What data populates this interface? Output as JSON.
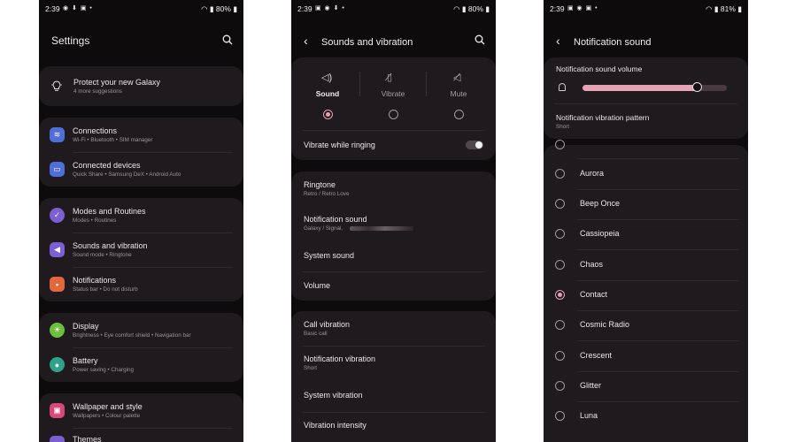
{
  "status": {
    "p1": {
      "time": "2:39",
      "right": "80%"
    },
    "p2": {
      "time": "2:39",
      "right": "80%"
    },
    "p3": {
      "time": "2:39",
      "right": "81%"
    }
  },
  "settings": {
    "title": "Settings",
    "promo": {
      "title": "Protect your new Galaxy",
      "subtitle": "4 more suggestions"
    },
    "items": [
      {
        "title": "Connections",
        "subtitle": "Wi-Fi  •  Bluetooth  •  SIM manager",
        "icon": "wifi-icon",
        "color": "#4f6ed8"
      },
      {
        "title": "Connected devices",
        "subtitle": "Quick Share  •  Samsung DeX  •  Android Auto",
        "icon": "devices-icon",
        "color": "#4f6ed8"
      },
      {
        "title": "Modes and Routines",
        "subtitle": "Modes  •  Routines",
        "icon": "check-circle-icon",
        "color": "#7b5fd3"
      },
      {
        "title": "Sounds and vibration",
        "subtitle": "Sound mode  •  Ringtone",
        "icon": "speaker-icon",
        "color": "#7b5fd3"
      },
      {
        "title": "Notifications",
        "subtitle": "Status bar  •  Do not disturb",
        "icon": "bell-icon",
        "color": "#e2683c"
      },
      {
        "title": "Display",
        "subtitle": "Brightness  •  Eye comfort shield  •  Navigation bar",
        "icon": "sun-icon",
        "color": "#6fbf3f"
      },
      {
        "title": "Battery",
        "subtitle": "Power saving  •  Charging",
        "icon": "battery-icon",
        "color": "#2fa38a"
      },
      {
        "title": "Wallpaper and style",
        "subtitle": "Wallpapers  •  Colour palette",
        "icon": "palette-icon",
        "color": "#d9467e"
      },
      {
        "title": "Themes",
        "subtitle": "",
        "icon": "themes-icon",
        "color": "#7b5fd3"
      }
    ]
  },
  "sounds": {
    "title": "Sounds and vibration",
    "modes": [
      {
        "label": "Sound",
        "selected": true
      },
      {
        "label": "Vibrate",
        "selected": false
      },
      {
        "label": "Mute",
        "selected": false
      }
    ],
    "vibrate_while_ringing": "Vibrate while ringing",
    "group1": [
      {
        "title": "Ringtone",
        "subtitle": "Retro / Retro Love"
      },
      {
        "title": "Notification sound",
        "subtitle": "Galaxy / Signal,"
      },
      {
        "title": "System sound",
        "subtitle": ""
      },
      {
        "title": "Volume",
        "subtitle": ""
      }
    ],
    "group2": [
      {
        "title": "Call vibration",
        "subtitle": "Basic call"
      },
      {
        "title": "Notification vibration",
        "subtitle": "Short"
      },
      {
        "title": "System vibration",
        "subtitle": ""
      },
      {
        "title": "Vibration intensity",
        "subtitle": ""
      }
    ]
  },
  "notif": {
    "title": "Notification sound",
    "volume_label": "Notification sound volume",
    "volume_level": 0.8,
    "pattern_label": "Notification vibration pattern",
    "pattern_value": "Short",
    "sounds": [
      {
        "name": "Aurora",
        "selected": false
      },
      {
        "name": "Beep Once",
        "selected": false
      },
      {
        "name": "Cassiopeia",
        "selected": false
      },
      {
        "name": "Chaos",
        "selected": false
      },
      {
        "name": "Contact",
        "selected": true
      },
      {
        "name": "Cosmic Radio",
        "selected": false
      },
      {
        "name": "Crescent",
        "selected": false
      },
      {
        "name": "Glitter",
        "selected": false
      },
      {
        "name": "Luna",
        "selected": false
      }
    ]
  },
  "colors": {
    "accent": "#e6a3b4",
    "card": "#1f1a1d",
    "background": "#0d0b0c"
  }
}
